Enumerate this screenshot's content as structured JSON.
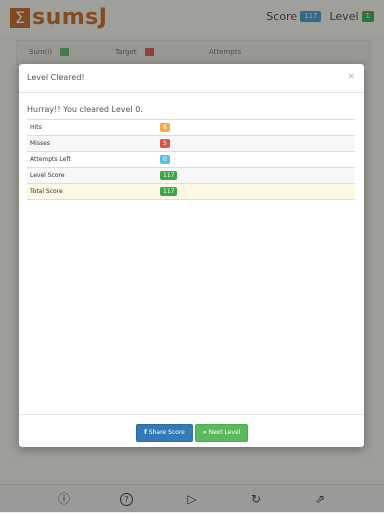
{
  "header": {
    "logo_mark": "Σ",
    "logo_text": "sumsJ",
    "score_label": "Score",
    "score_value": "117",
    "level_label": "Level",
    "level_value": "1"
  },
  "stats": {
    "sum_label": "Sum(i)",
    "target_label": "Target",
    "attempts_label": "Attempts"
  },
  "footer": {
    "info_icon": "ⓘ",
    "help_icon": "?",
    "play_icon": "▷",
    "restart_icon": "↻",
    "share_icon": "⇗"
  },
  "modal": {
    "title": "Level Cleared!",
    "close": "×",
    "message": "Hurray!! You cleared Level 0.",
    "rows": [
      {
        "label": "Hits",
        "value": "6",
        "color": "#f0ad4e"
      },
      {
        "label": "Misses",
        "value": "5",
        "color": "#d9534f"
      },
      {
        "label": "Attempts Left",
        "value": "0",
        "color": "#5bc0de"
      },
      {
        "label": "Level Score",
        "value": "117",
        "color": "#5cb85c"
      },
      {
        "label": "Total Score",
        "value": "117",
        "color": "#5cb85c"
      }
    ],
    "share_icon": "f",
    "share_label": "Share Score",
    "next_icon": "»",
    "next_label": "Next Level"
  }
}
